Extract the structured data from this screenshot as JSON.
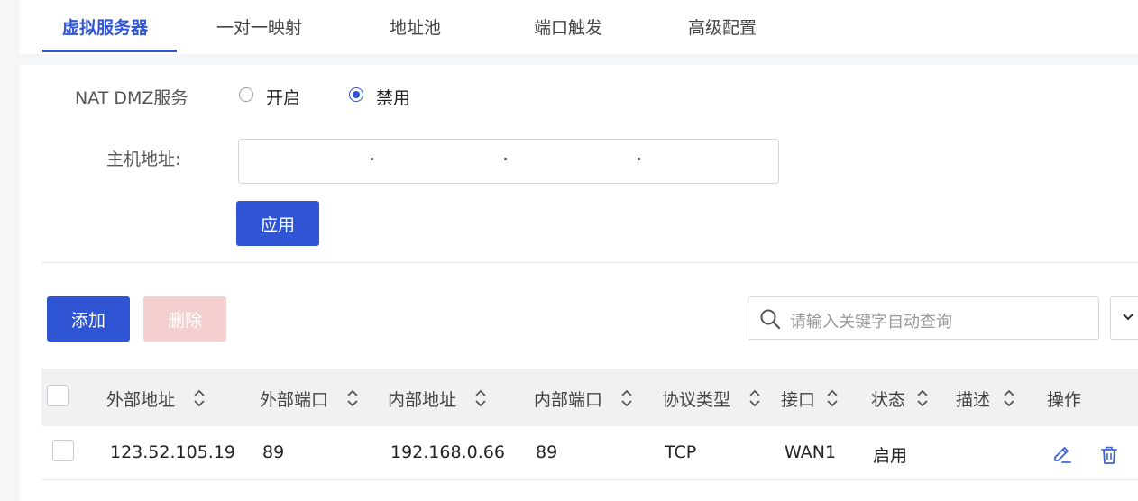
{
  "tabs": [
    {
      "label": "虚拟服务器",
      "active": true
    },
    {
      "label": "一对一映射",
      "active": false
    },
    {
      "label": "地址池",
      "active": false
    },
    {
      "label": "端口触发",
      "active": false
    },
    {
      "label": "高级配置",
      "active": false
    }
  ],
  "dmz": {
    "label": "NAT DMZ服务",
    "options": [
      {
        "label": "开启",
        "checked": false
      },
      {
        "label": "禁用",
        "checked": true
      }
    ],
    "host_label": "主机地址:",
    "ip_octets": [
      "",
      "",
      "",
      ""
    ],
    "apply_label": "应用"
  },
  "toolbar": {
    "add_label": "添加",
    "delete_label": "删除",
    "search_placeholder": "请输入关键字自动查询"
  },
  "table": {
    "columns": [
      "外部地址",
      "外部端口",
      "内部地址",
      "内部端口",
      "协议类型",
      "接口",
      "状态",
      "描述",
      "操作"
    ],
    "rows": [
      {
        "external_address": "123.52.105.19",
        "external_port": "89",
        "internal_address": "192.168.0.66",
        "internal_port": "89",
        "protocol": "TCP",
        "interface": "WAN1",
        "status": "启用",
        "description": ""
      }
    ]
  },
  "colors": {
    "accent": "#2f55d4",
    "disabled_button": "#f3cfcf"
  }
}
